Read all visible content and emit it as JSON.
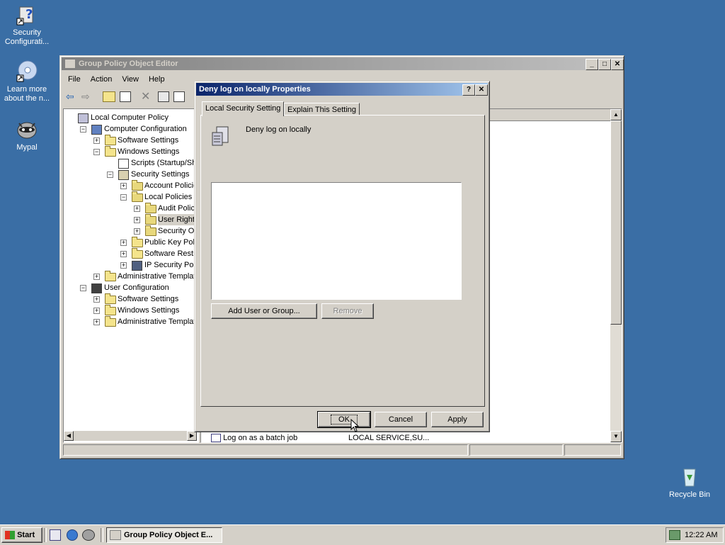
{
  "desktop": {
    "icons": [
      {
        "label": "Security Configurati...",
        "icon": "security-config-icon"
      },
      {
        "label": "Learn more about the n...",
        "icon": "cd-learn-icon"
      },
      {
        "label": "Mypal",
        "icon": "mypal-raccoon-icon"
      },
      {
        "label": "Recycle Bin",
        "icon": "recycle-bin-icon"
      }
    ]
  },
  "gpo_window": {
    "title": "Group Policy Object Editor",
    "menu": [
      "File",
      "Action",
      "View",
      "Help"
    ],
    "tree": [
      {
        "label": "Local Computer Policy"
      },
      {
        "label": "Computer Configuration"
      },
      {
        "label": "Software Settings"
      },
      {
        "label": "Windows Settings"
      },
      {
        "label": "Scripts (Startup/Shutd"
      },
      {
        "label": "Security Settings"
      },
      {
        "label": "Account Policies"
      },
      {
        "label": "Local Policies"
      },
      {
        "label": "Audit Policy"
      },
      {
        "label": "User Rights A"
      },
      {
        "label": "Security Optic"
      },
      {
        "label": "Public Key Policies"
      },
      {
        "label": "Software Restrict"
      },
      {
        "label": "IP Security Policie"
      },
      {
        "label": "Administrative Templates"
      },
      {
        "label": "User Configuration"
      },
      {
        "label": "Software Settings"
      },
      {
        "label": "Windows Settings"
      },
      {
        "label": "Administrative Templates"
      }
    ],
    "list_partial": {
      "policy": "Log on as a batch job",
      "setting": "LOCAL SERVICE,SU..."
    }
  },
  "dialog": {
    "title": "Deny log on locally Properties",
    "help_button": "?",
    "close_button": "✕",
    "tabs": [
      "Local Security Setting",
      "Explain This Setting"
    ],
    "setting_name": "Deny log on locally",
    "add_button": "Add User or Group...",
    "remove_button": "Remove",
    "ok_button": "OK",
    "cancel_button": "Cancel",
    "apply_button": "Apply"
  },
  "taskbar": {
    "start_label": "Start",
    "task_label": "Group Policy Object E...",
    "clock": "12:22 AM"
  }
}
